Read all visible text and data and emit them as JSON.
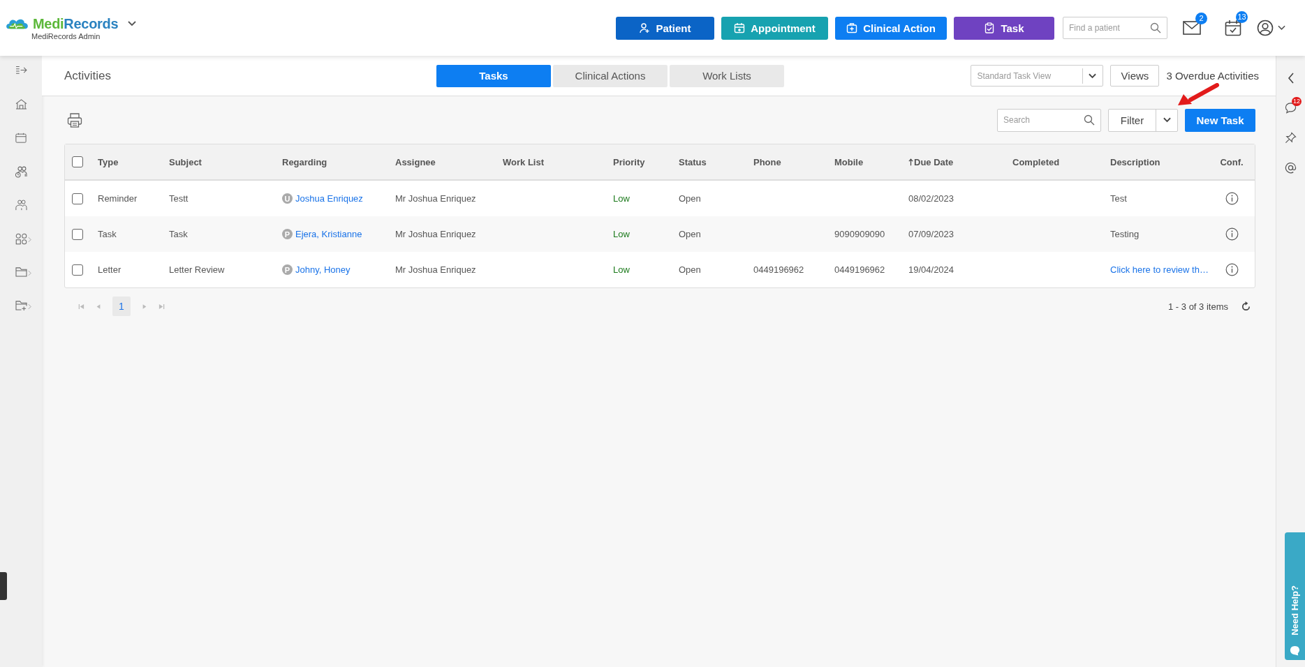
{
  "header": {
    "brand_parts": [
      "Medi",
      "Records"
    ],
    "subtitle": "MediRecords Admin",
    "buttons": [
      {
        "label": "Patient",
        "kind": "patient"
      },
      {
        "label": "Appointment",
        "kind": "appointment"
      },
      {
        "label": "Clinical Action",
        "kind": "clinical"
      },
      {
        "label": "Task",
        "kind": "task"
      }
    ],
    "search": {
      "placeholder": "Find a patient"
    },
    "mail_badge": "2",
    "calendar_badge": "13"
  },
  "sidebar": {
    "items": [
      {
        "expandable": false
      },
      {
        "expandable": false
      },
      {
        "expandable": false
      },
      {
        "expandable": false
      },
      {
        "expandable": false
      },
      {
        "expandable": true
      },
      {
        "expandable": true
      },
      {
        "expandable": true
      }
    ]
  },
  "page_title": "Activities",
  "tabs": [
    {
      "label": "Tasks",
      "selected": true
    },
    {
      "label": "Clinical Actions",
      "selected": false
    },
    {
      "label": "Work Lists",
      "selected": false
    }
  ],
  "view_select": {
    "value": "Standard Task View"
  },
  "views_button": "Views",
  "overdue": "3 Overdue Activities",
  "toolbar": {
    "search": {
      "placeholder": "Search"
    },
    "filter_button": "Filter",
    "new_task_button": "New Task"
  },
  "table": {
    "header_checked": false,
    "columns": [
      {
        "label": "Type",
        "sorted": false
      },
      {
        "label": "Subject",
        "sorted": false
      },
      {
        "label": "Regarding",
        "sorted": false
      },
      {
        "label": "Assignee",
        "sorted": false
      },
      {
        "label": "Work List",
        "sorted": false
      },
      {
        "label": "Priority",
        "sorted": false
      },
      {
        "label": "Status",
        "sorted": false
      },
      {
        "label": "Phone",
        "sorted": false
      },
      {
        "label": "Mobile",
        "sorted": false
      },
      {
        "label": "Due Date",
        "sorted": true
      },
      {
        "label": "Completed",
        "sorted": false
      },
      {
        "label": "Description",
        "sorted": false
      },
      {
        "label": "Conf.",
        "sorted": false
      }
    ],
    "rows": [
      {
        "checked": false,
        "type": "Reminder",
        "subject": "Testt",
        "regarding": {
          "badge": "U",
          "name": "Joshua Enriquez"
        },
        "assignee": "Mr Joshua Enriquez",
        "priority": "Low",
        "status": "Open",
        "due_date": "08/02/2023",
        "description": {
          "text": "Test",
          "link": false
        }
      },
      {
        "checked": false,
        "type": "Task",
        "subject": "Task",
        "regarding": {
          "badge": "P",
          "name": "Ejera, Kristianne"
        },
        "assignee": "Mr Joshua Enriquez",
        "priority": "Low",
        "status": "Open",
        "mobile": "9090909090",
        "due_date": "07/09/2023",
        "description": {
          "text": "Testing",
          "link": false
        }
      },
      {
        "checked": false,
        "type": "Letter",
        "subject": "Letter Review",
        "regarding": {
          "badge": "P",
          "name": "Johny, Honey"
        },
        "assignee": "Mr Joshua Enriquez",
        "priority": "Low",
        "status": "Open",
        "phone": "0449196962",
        "mobile": "0449196962",
        "due_date": "19/04/2024",
        "description": {
          "text": "Click here to review th…",
          "link": true
        }
      }
    ]
  },
  "pagination": {
    "pages": [
      {
        "label": "1",
        "selected": true
      }
    ],
    "summary": "1 - 3 of 3 items"
  },
  "right_panel": {
    "chat_badge": "12",
    "help_tab": "Need Help?"
  }
}
